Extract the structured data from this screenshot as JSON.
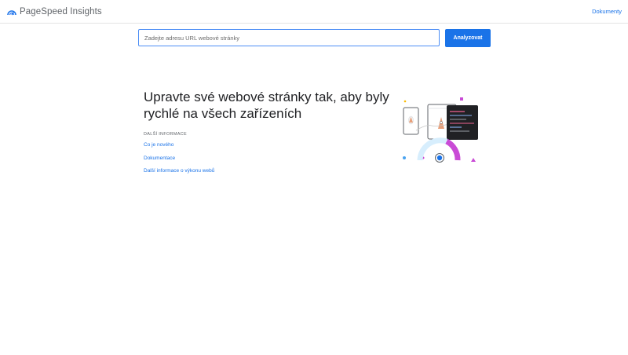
{
  "header": {
    "app_name": "PageSpeed Insights",
    "docs_link": "Dokumenty",
    "logo_icon": "pagespeed-gauge-icon",
    "accent_color": "#1a73e8"
  },
  "search": {
    "placeholder": "Zadejte adresu URL webové stránky",
    "value": "",
    "button_label": "Analyzovat"
  },
  "hero": {
    "title": "Upravte své webové stránky tak, aby byly rychlé na všech zařízeních",
    "section_label": "DALŠÍ INFORMACE",
    "links": [
      "Co je nového",
      "Dokumentace",
      "Další informace o výkonu webů"
    ],
    "illustration_icon": "devices-speed-gauge-illustration"
  }
}
